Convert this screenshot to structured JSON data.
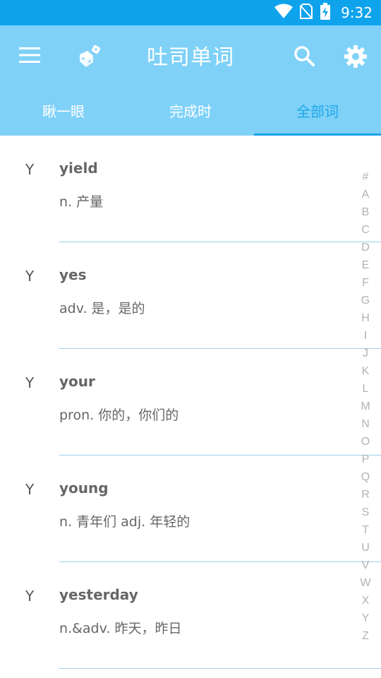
{
  "status_bar": {
    "time": "9:32"
  },
  "app_bar": {
    "title": "吐司单词"
  },
  "tabs": [
    {
      "label": "瞅一眼",
      "active": false
    },
    {
      "label": "完成时",
      "active": false
    },
    {
      "label": "全部词",
      "active": true
    }
  ],
  "words": [
    {
      "letter": "Y",
      "word": "yield",
      "meaning": "n. 产量"
    },
    {
      "letter": "Y",
      "word": "yes",
      "meaning": "adv. 是，是的"
    },
    {
      "letter": "Y",
      "word": "your",
      "meaning": "pron. 你的，你们的"
    },
    {
      "letter": "Y",
      "word": "young",
      "meaning": "n. 青年们 adj. 年轻的"
    },
    {
      "letter": "Y",
      "word": "yesterday",
      "meaning": "n.&adv. 昨天，昨日"
    }
  ],
  "index_letters": [
    "#",
    "A",
    "B",
    "C",
    "D",
    "E",
    "F",
    "G",
    "H",
    "I",
    "J",
    "K",
    "L",
    "M",
    "N",
    "O",
    "P",
    "Q",
    "R",
    "S",
    "T",
    "U",
    "V",
    "W",
    "X",
    "Y",
    "Z"
  ]
}
